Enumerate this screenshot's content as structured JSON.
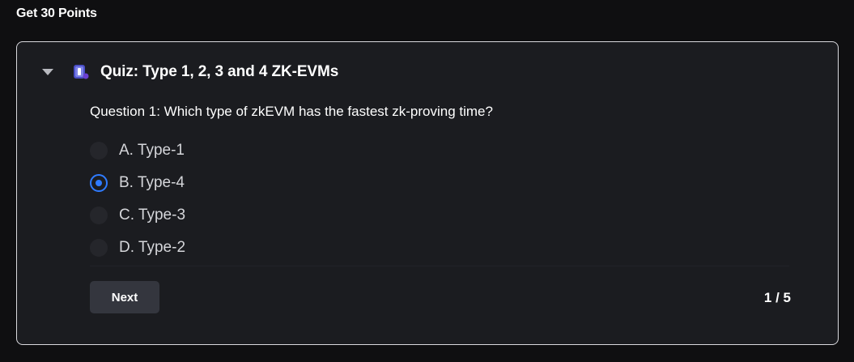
{
  "section": {
    "title": "Get 30 Points"
  },
  "quiz": {
    "title": "Quiz: Type 1, 2, 3 and 4 ZK-EVMs",
    "icon": "quiz-badge-icon",
    "question": "Question 1: Which type of zkEVM has the fastest zk-proving time?",
    "options": [
      {
        "label": "A. Type-1",
        "selected": false
      },
      {
        "label": "B. Type-4",
        "selected": true
      },
      {
        "label": "C. Type-3",
        "selected": false
      },
      {
        "label": "D. Type-2",
        "selected": false
      }
    ],
    "next_label": "Next",
    "page_indicator": "1 / 5",
    "accent_color": "#2f7bff"
  }
}
